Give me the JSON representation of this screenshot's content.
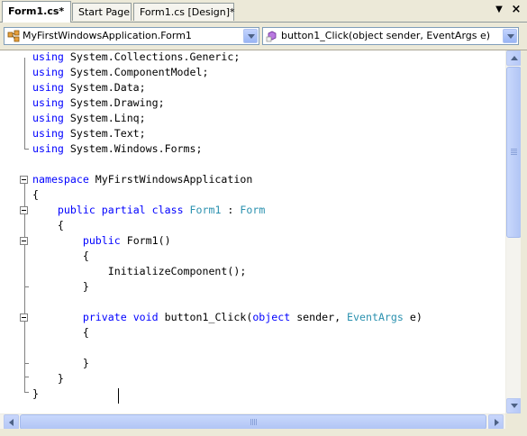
{
  "tabs": [
    {
      "label": "Form1.cs*",
      "active": true
    },
    {
      "label": "Start Page",
      "active": false
    },
    {
      "label": "Form1.cs [Design]*",
      "active": false
    }
  ],
  "tab_controls": {
    "dropdown_glyph": "▼",
    "close_glyph": "×"
  },
  "nav": {
    "type_combo": {
      "value": "MyFirstWindowsApplication.Form1",
      "icon": "class-icon"
    },
    "member_combo": {
      "value": "button1_Click(object sender, EventArgs e)",
      "icon": "method-icon"
    }
  },
  "code": {
    "lines": [
      [
        {
          "t": "using",
          "c": "kw"
        },
        {
          "t": " System.Collections.Generic;"
        }
      ],
      [
        {
          "t": "using",
          "c": "kw"
        },
        {
          "t": " System.ComponentModel;"
        }
      ],
      [
        {
          "t": "using",
          "c": "kw"
        },
        {
          "t": " System.Data;"
        }
      ],
      [
        {
          "t": "using",
          "c": "kw"
        },
        {
          "t": " System.Drawing;"
        }
      ],
      [
        {
          "t": "using",
          "c": "kw"
        },
        {
          "t": " System.Linq;"
        }
      ],
      [
        {
          "t": "using",
          "c": "kw"
        },
        {
          "t": " System.Text;"
        }
      ],
      [
        {
          "t": "using",
          "c": "kw"
        },
        {
          "t": " System.Windows.Forms;"
        }
      ],
      [],
      [
        {
          "t": "namespace",
          "c": "kw"
        },
        {
          "t": " MyFirstWindowsApplication"
        }
      ],
      [
        {
          "t": "{"
        }
      ],
      [
        {
          "t": "    "
        },
        {
          "t": "public",
          "c": "kw"
        },
        {
          "t": " "
        },
        {
          "t": "partial",
          "c": "kw"
        },
        {
          "t": " "
        },
        {
          "t": "class",
          "c": "kw"
        },
        {
          "t": " "
        },
        {
          "t": "Form1",
          "c": "ty"
        },
        {
          "t": " : "
        },
        {
          "t": "Form",
          "c": "ty"
        }
      ],
      [
        {
          "t": "    {"
        }
      ],
      [
        {
          "t": "        "
        },
        {
          "t": "public",
          "c": "kw"
        },
        {
          "t": " Form1()"
        }
      ],
      [
        {
          "t": "        {"
        }
      ],
      [
        {
          "t": "            InitializeComponent();"
        }
      ],
      [
        {
          "t": "        }"
        }
      ],
      [],
      [
        {
          "t": "        "
        },
        {
          "t": "private",
          "c": "kw"
        },
        {
          "t": " "
        },
        {
          "t": "void",
          "c": "kw"
        },
        {
          "t": " button1_Click("
        },
        {
          "t": "object",
          "c": "kw"
        },
        {
          "t": " sender, "
        },
        {
          "t": "EventArgs",
          "c": "ty"
        },
        {
          "t": " e)"
        }
      ],
      [
        {
          "t": "        {"
        }
      ],
      [
        {
          "t": "            "
        }
      ],
      [
        {
          "t": "        }"
        }
      ],
      [
        {
          "t": "    }"
        }
      ],
      [
        {
          "t": "}"
        }
      ]
    ]
  },
  "colors": {
    "keyword": "#0000ff",
    "type": "#2b91af",
    "text": "#000000"
  }
}
